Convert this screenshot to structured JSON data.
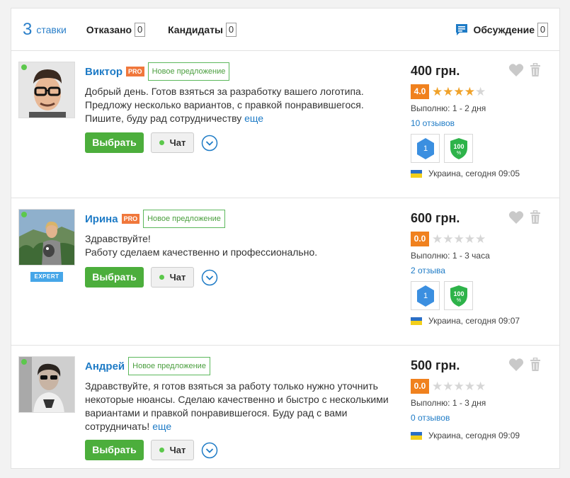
{
  "tabs": {
    "bids_count": "3",
    "bids_label": "ставки",
    "rejected_label": "Отказано",
    "rejected_count": "0",
    "candidates_label": "Кандидаты",
    "candidates_count": "0",
    "discussion_label": "Обсуждение",
    "discussion_count": "0"
  },
  "colors": {
    "accent": "#1e7bc6",
    "select_button": "#4cae3c",
    "pro_badge": "#f0773b",
    "rating_box": "#f0811e",
    "star_on": "#f0a22a",
    "online": "#5cc84c"
  },
  "bids": [
    {
      "name": "Виктор",
      "pro": "PRO",
      "new_tag": "Новое предложение",
      "message": "Добрый день. Готов взяться за разработку вашего логотипа. Предложу несколько вариантов, с правкой понравившегося. Пишите, буду рад сотрудничеству",
      "more": "еще",
      "select": "Выбрать",
      "chat": "Чат",
      "price": "400 грн.",
      "rating": "4.0",
      "stars": 4,
      "duration": "Выполню: 1 - 2 дня",
      "reviews": "10 отзывов",
      "badge_level": "1",
      "badge_percent": "100",
      "location": "Украина, сегодня 09:05"
    },
    {
      "name": "Ирина",
      "pro": "PRO",
      "new_tag": "Новое предложение",
      "expert": "EXPERT",
      "message_line1": "Здравствуйте!",
      "message_line2": "Работу сделаем качественно и профессионально.",
      "select": "Выбрать",
      "chat": "Чат",
      "price": "600 грн.",
      "rating": "0.0",
      "stars": 0,
      "duration": "Выполню: 1 - 3 часа",
      "reviews": "2 отзыва",
      "badge_level": "1",
      "badge_percent": "100",
      "location": "Украина, сегодня 09:07"
    },
    {
      "name": "Андрей",
      "new_tag": "Новое предложение",
      "message": "Здравствуйте, я готов взяться за работу только нужно уточнить некоторые нюансы. Сделаю качественно и быстро с несколькими вариантами и правкой понравившегося. Буду рад с вами сотрудничать!",
      "more": "еще",
      "select": "Выбрать",
      "chat": "Чат",
      "price": "500 грн.",
      "rating": "0.0",
      "stars": 0,
      "duration": "Выполню: 1 - 3 дня",
      "reviews": "0 отзывов",
      "location": "Украина, сегодня 09:09"
    }
  ]
}
